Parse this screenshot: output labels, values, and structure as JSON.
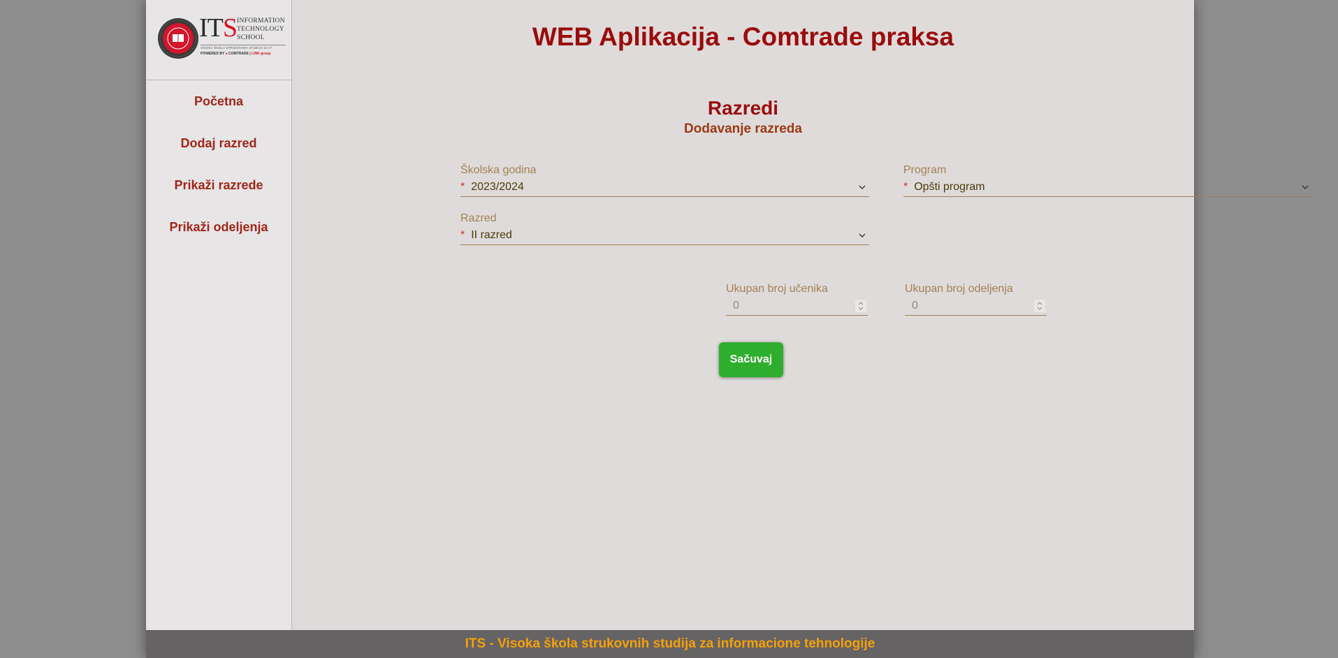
{
  "logo": {
    "letters_it": "IT",
    "letter_s": "S",
    "words": [
      "INFORMATION",
      "TECHNOLOGY",
      "SCHOOL"
    ],
    "tagline": "VISOKA ŠKOLA STRUKOVNIH STUDIJA ZA IT",
    "powered_prefix": "POWERED BY",
    "powered_brand": "COMTRADE",
    "powered_group": "LINK group"
  },
  "app_title": "WEB Aplikacija - Comtrade praksa",
  "sidebar": {
    "items": [
      {
        "label": "Početna"
      },
      {
        "label": "Dodaj razred"
      },
      {
        "label": "Prikaži razrede"
      },
      {
        "label": "Prikaži odeljenja"
      }
    ]
  },
  "page": {
    "title": "Razredi",
    "subtitle": "Dodavanje razreda"
  },
  "form": {
    "school_year": {
      "label": "Školska godina",
      "required_mark": "*",
      "value": "2023/2024"
    },
    "program": {
      "label": "Program",
      "required_mark": "*",
      "value": "Opšti program"
    },
    "grade": {
      "label": "Razred",
      "required_mark": "*",
      "value": "II razred"
    },
    "total_students": {
      "label": "Ukupan broj učenika",
      "value": "0"
    },
    "total_departments": {
      "label": "Ukupan broj odeljenja",
      "value": "0"
    },
    "save_label": "Sačuvaj"
  },
  "footer": {
    "text": "ITS - Visoka škola strukovnih studija za informacione tehnologije"
  },
  "colors": {
    "title": "#9b0b0b",
    "nav_link": "#a1261a",
    "label": "#a38154",
    "save_button": "#2fae2d",
    "footer_text": "#f5a00a",
    "footer_bg": "#656363"
  }
}
